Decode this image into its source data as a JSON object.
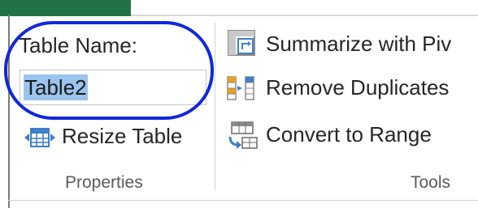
{
  "properties_group": {
    "table_name_label": "Table Name:",
    "table_name_value": "Table2",
    "resize_table_label": "Resize Table",
    "group_label": "Properties"
  },
  "tools_group": {
    "summarize_label": "Summarize with Piv",
    "remove_duplicates_label": "Remove Duplicates",
    "convert_to_range_label": "Convert to Range",
    "group_label": "Tools"
  },
  "colors": {
    "excel_green": "#217346",
    "annotation_blue": "#1028dc",
    "selection_blue": "#9bc4ee"
  },
  "icons": {
    "resize_table": "resize-table-icon",
    "summarize_pivot": "pivot-table-icon",
    "remove_duplicates": "remove-duplicates-icon",
    "convert_to_range": "convert-to-range-icon"
  }
}
